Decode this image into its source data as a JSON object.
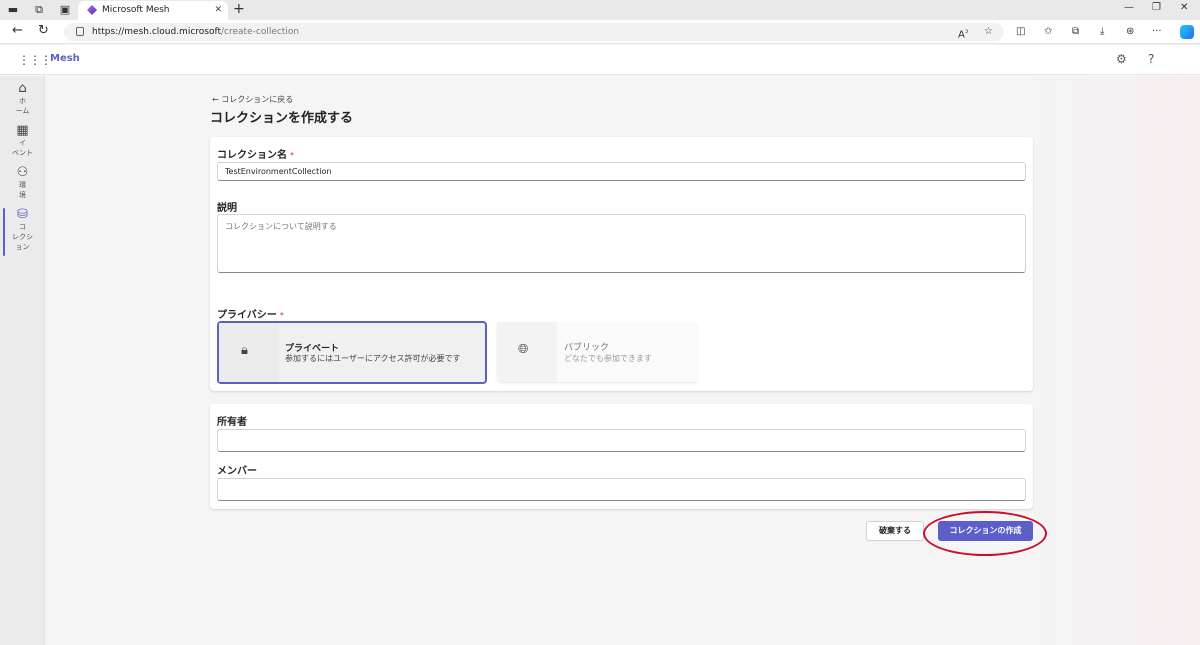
{
  "browser": {
    "tab_title": "Microsoft Mesh",
    "tab_close": "✕",
    "new_tab": "+",
    "url_host": "https://mesh.cloud.microsoft",
    "url_path": "/create-collection",
    "window_controls": [
      "—",
      "❐",
      "✕"
    ]
  },
  "app": {
    "brand": "Mesh",
    "settings_icon": "gear-icon",
    "help_label": "?"
  },
  "rail": {
    "items": [
      {
        "icon": "home-icon",
        "label": "ホ\nーム"
      },
      {
        "icon": "calendar-icon",
        "label": "イ\nベント"
      },
      {
        "icon": "people-icon",
        "label": "環\n境"
      },
      {
        "icon": "collection-icon",
        "label": "コ\nレクシ\nョン",
        "active": true
      }
    ]
  },
  "page": {
    "back_label": "コレクションに戻る",
    "title": "コレクションを作成する"
  },
  "form": {
    "name_label": "コレクション名",
    "name_value": "TestEnvironmentCollection",
    "required_mark": "*",
    "description_label": "説明",
    "description_placeholder": "コレクションについて説明する",
    "privacy_label": "プライバシー",
    "privacy_options": [
      {
        "title": "プライベート",
        "description": "参加するにはユーザーにアクセス許可が必要です",
        "selected": true,
        "icon": "lock-icon"
      },
      {
        "title": "パブリック",
        "description": "どなたでも参加できます",
        "selected": false,
        "icon": "globe-icon"
      }
    ],
    "owner_label": "所有者",
    "owner_value": "",
    "members_label": "メンバー",
    "members_value": ""
  },
  "actions": {
    "discard_label": "破棄する",
    "create_label": "コレクションの作成"
  },
  "colors": {
    "accent": "#5b5fc7",
    "annotation": "#c8102e"
  }
}
